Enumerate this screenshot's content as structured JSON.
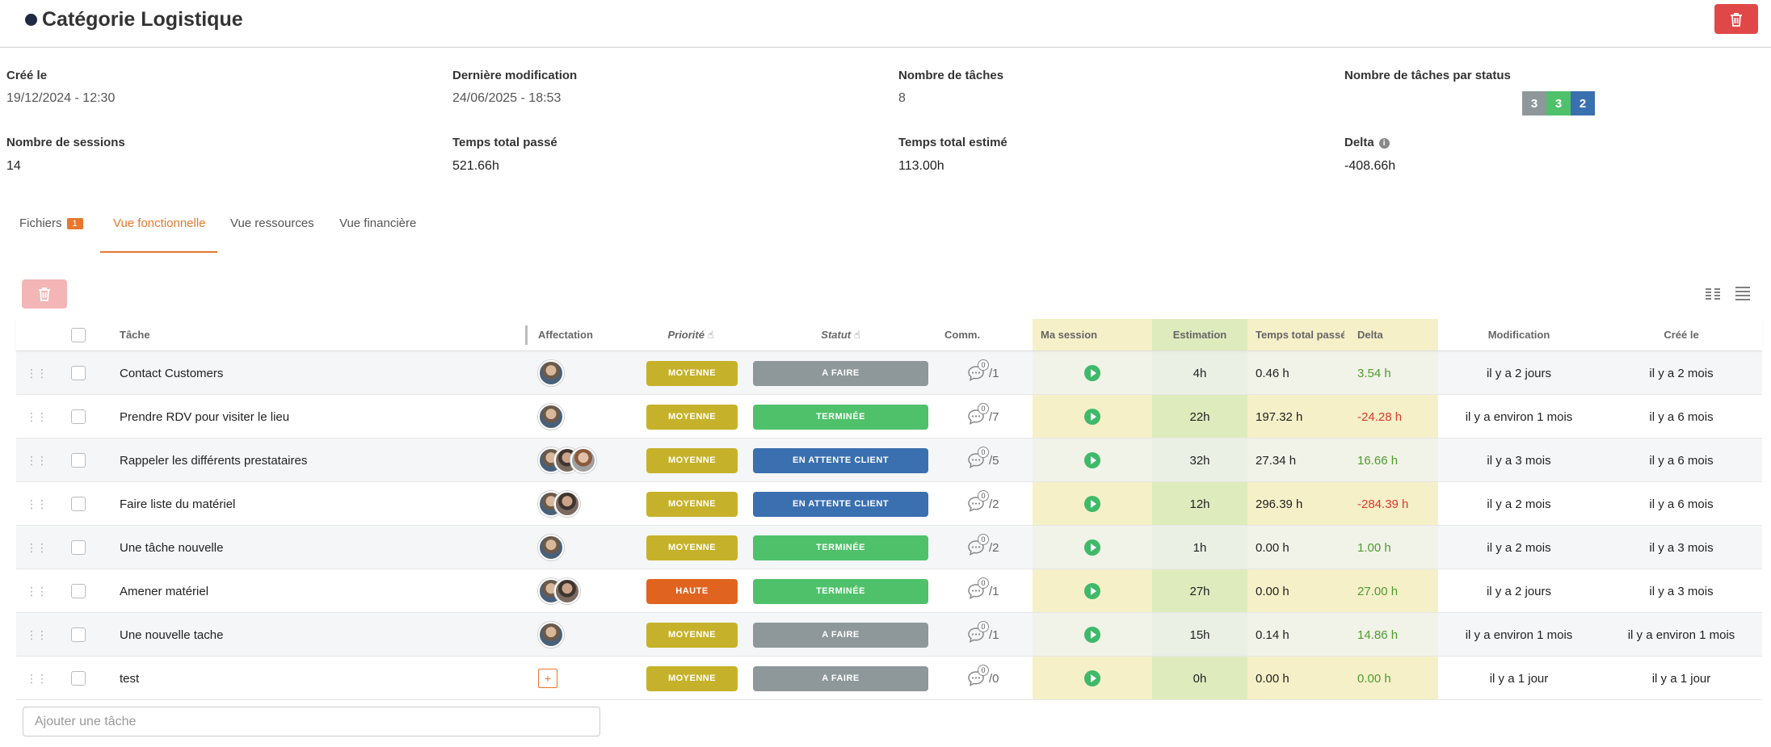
{
  "header": {
    "title": "Catégorie Logistique"
  },
  "info": {
    "created_label": "Créé le",
    "created_value": "19/12/2024 - 12:30",
    "modified_label": "Dernière modification",
    "modified_value": "24/06/2025 - 18:53",
    "tasks_label": "Nombre de tâches",
    "tasks_value": "8",
    "tasks_by_status_label": "Nombre de tâches par status",
    "status_counts": [
      {
        "value": "3",
        "color": "#8e979a"
      },
      {
        "value": "3",
        "color": "#4fc16a"
      },
      {
        "value": "2",
        "color": "#3a6fb0"
      }
    ],
    "sessions_label": "Nombre de sessions",
    "sessions_value": "14",
    "time_spent_label": "Temps total passé",
    "time_spent_value": "521.66h",
    "time_estimated_label": "Temps total estimé",
    "time_estimated_value": "113.00h",
    "delta_label": "Delta",
    "delta_value": "-408.66h"
  },
  "tabs": [
    {
      "label": "Fichiers",
      "badge": "1"
    },
    {
      "label": "Vue fonctionnelle"
    },
    {
      "label": "Vue ressources"
    },
    {
      "label": "Vue financière"
    }
  ],
  "table": {
    "headers": {
      "task": "Tâche",
      "assign": "Affectation",
      "priority": "Priorité",
      "status": "Statut",
      "comm": "Comm.",
      "session": "Ma session",
      "estimation": "Estimation",
      "spent": "Temps total passé",
      "delta": "Delta",
      "modified": "Modification",
      "created": "Créé le"
    },
    "colors": {
      "moyenne": "#c6b22a",
      "haute": "#e06420",
      "a_faire": "#8e979a",
      "terminee": "#4fc16a",
      "attente": "#3a6fb0"
    },
    "rows": [
      {
        "task": "Contact Customers",
        "avatars": 1,
        "priority": "MOYENNE",
        "prio_color": "#c6b22a",
        "status": "A FAIRE",
        "status_color": "#8e979a",
        "comm_count": "0",
        "comm_total": "/1",
        "estimation": "4h",
        "spent": "0.46 h",
        "delta": "3.54 h",
        "delta_sign": "pos",
        "modified": "il y a 2 jours",
        "created": "il y a 2 mois"
      },
      {
        "task": "Prendre RDV pour visiter le lieu",
        "avatars": 1,
        "priority": "MOYENNE",
        "prio_color": "#c6b22a",
        "status": "TERMINÉE",
        "status_color": "#4fc16a",
        "comm_count": "0",
        "comm_total": "/7",
        "estimation": "22h",
        "spent": "197.32 h",
        "delta": "-24.28 h",
        "delta_sign": "neg",
        "modified": "il y a environ 1 mois",
        "created": "il y a 6 mois"
      },
      {
        "task": "Rappeler les différents prestataires",
        "avatars": 3,
        "priority": "MOYENNE",
        "prio_color": "#c6b22a",
        "status": "EN ATTENTE CLIENT",
        "status_color": "#3a6fb0",
        "comm_count": "0",
        "comm_total": "/5",
        "estimation": "32h",
        "spent": "27.34 h",
        "delta": "16.66 h",
        "delta_sign": "pos",
        "modified": "il y a 3 mois",
        "created": "il y a 6 mois"
      },
      {
        "task": "Faire liste du matériel",
        "avatars": 2,
        "priority": "MOYENNE",
        "prio_color": "#c6b22a",
        "status": "EN ATTENTE CLIENT",
        "status_color": "#3a6fb0",
        "comm_count": "0",
        "comm_total": "/2",
        "estimation": "12h",
        "spent": "296.39 h",
        "delta": "-284.39 h",
        "delta_sign": "neg",
        "modified": "il y a 2 mois",
        "created": "il y a 6 mois"
      },
      {
        "task": "Une tâche nouvelle",
        "avatars": 1,
        "priority": "MOYENNE",
        "prio_color": "#c6b22a",
        "status": "TERMINÉE",
        "status_color": "#4fc16a",
        "comm_count": "0",
        "comm_total": "/2",
        "estimation": "1h",
        "spent": "0.00 h",
        "delta": "1.00 h",
        "delta_sign": "pos",
        "modified": "il y a 2 mois",
        "created": "il y a 3 mois"
      },
      {
        "task": "Amener matériel",
        "avatars": 2,
        "priority": "HAUTE",
        "prio_color": "#e06420",
        "status": "TERMINÉE",
        "status_color": "#4fc16a",
        "comm_count": "0",
        "comm_total": "/1",
        "estimation": "27h",
        "spent": "0.00 h",
        "delta": "27.00 h",
        "delta_sign": "pos",
        "modified": "il y a 2 jours",
        "created": "il y a 3 mois"
      },
      {
        "task": "Une nouvelle tache",
        "avatars": 1,
        "priority": "MOYENNE",
        "prio_color": "#c6b22a",
        "status": "A FAIRE",
        "status_color": "#8e979a",
        "comm_count": "0",
        "comm_total": "/1",
        "estimation": "15h",
        "spent": "0.14 h",
        "delta": "14.86 h",
        "delta_sign": "pos",
        "modified": "il y a environ 1 mois",
        "created": "il y a environ 1 mois"
      },
      {
        "task": "test",
        "avatars": 0,
        "priority": "MOYENNE",
        "prio_color": "#c6b22a",
        "status": "A FAIRE",
        "status_color": "#8e979a",
        "comm_count": "0",
        "comm_total": "/0",
        "estimation": "0h",
        "spent": "0.00 h",
        "delta": "0.00 h",
        "delta_sign": "pos",
        "modified": "il y a 1 jour",
        "created": "il y a 1 jour"
      }
    ]
  },
  "add_task": {
    "placeholder": "Ajouter une tâche",
    "add_symbol": "+"
  },
  "icons": {
    "delete": "trash-icon",
    "drag": "drag-handle-icon",
    "comment": "comment-icon",
    "play": "play-icon",
    "info": "info-icon",
    "view_grid": "view-columns-icon",
    "view_list": "view-list-icon",
    "sort": "hand-sort-icon"
  }
}
